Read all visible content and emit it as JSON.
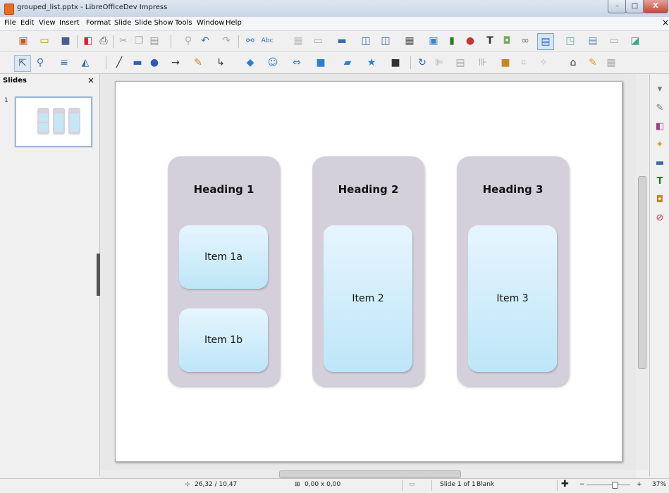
{
  "window": {
    "title": "grouped_list.pptx - LibreOfficeDev Impress",
    "min": "–",
    "max": "□",
    "close": "X"
  },
  "menu": [
    "File",
    "Edit",
    "View",
    "Insert",
    "Format",
    "Slide",
    "Slide Show",
    "Tools",
    "Window",
    "Help"
  ],
  "menu_close": "×",
  "toolbar1_icons": [
    "new-slide-icon",
    "open-icon",
    "save-icon",
    "export-pdf-icon",
    "print-icon",
    "cut-icon",
    "copy-icon",
    "paste-icon",
    "clone-formatting-icon",
    "undo-icon",
    "redo-icon",
    "find-replace-icon",
    "spelling-icon",
    "grid-icon",
    "display-views-icon",
    "slide-layout-icon",
    "start-first-slide-icon",
    "start-current-slide-icon",
    "table-icon",
    "image-icon",
    "chart-icon",
    "media-icon",
    "text-box-icon",
    "fontwork-icon",
    "special-character-icon",
    "hyperlink-icon",
    "interaction-icon",
    "master-slides-icon",
    "sidebar-icon"
  ],
  "toolbar2_icons": [
    "select-icon",
    "zoom-icon",
    "line-color-icon",
    "fill-color-icon",
    "line-icon",
    "rectangle-icon",
    "ellipse-icon",
    "arrow-icon",
    "curve-icon",
    "connector-icon",
    "basic-shapes-icon",
    "symbol-shapes-icon",
    "block-arrows-icon",
    "flowchart-icon",
    "callouts-icon",
    "stars-icon",
    "3d-objects-icon",
    "rotate-icon",
    "align-icon",
    "arrange-icon",
    "distribute-icon",
    "shadow-icon",
    "crop-icon",
    "filter-icon",
    "points-icon",
    "glue-points-icon",
    "toggle-extrusion-icon"
  ],
  "slides_panel": {
    "title": "Slides",
    "close": "×",
    "slide_number": "1"
  },
  "slide": {
    "groups": [
      {
        "heading": "Heading 1",
        "items": [
          "Item 1a",
          "Item 1b"
        ]
      },
      {
        "heading": "Heading 2",
        "items": [
          "Item 2"
        ]
      },
      {
        "heading": "Heading 3",
        "items": [
          "Item 3"
        ]
      }
    ]
  },
  "right_sidebar_icons": [
    "properties-icon",
    "styles-icon",
    "gallery-icon",
    "navigator-icon",
    "animation-icon",
    "slide-transition-icon",
    "master-slides-icon"
  ],
  "status": {
    "position": "26,32 / 10,47",
    "size": "0,00 x 0,00",
    "slide_info": "Slide 1 of 1",
    "layout": "Blank",
    "zoom": "37%",
    "zoom_minus": "−",
    "zoom_plus": "+"
  },
  "colors": {
    "group_bg": "#d4d0db",
    "item_top": "#e6f5fd",
    "item_bottom": "#bde6f8"
  }
}
